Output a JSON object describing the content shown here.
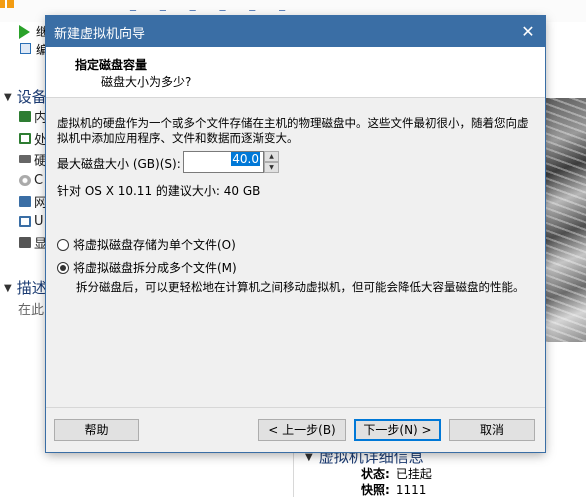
{
  "background": {
    "sidebar": {
      "truncated_items": [
        "继",
        "编"
      ],
      "devices_heading": "设备",
      "device_items": [
        {
          "label": "内",
          "icon": "memory-icon",
          "color": "#2e7d32"
        },
        {
          "label": "处",
          "icon": "processor-icon",
          "color": "#2e7d32"
        },
        {
          "label": "硬",
          "icon": "harddisk-icon",
          "color": "#555555"
        },
        {
          "label": "C",
          "icon": "cdrom-icon",
          "color": "#888888"
        },
        {
          "label": "网",
          "icon": "network-icon",
          "color": "#3a6ea5"
        },
        {
          "label": "U",
          "icon": "usb-icon",
          "color": "#3a6ea5"
        },
        {
          "label": "显",
          "icon": "display-icon",
          "color": "#555555"
        }
      ],
      "description_heading": "描述",
      "description_hint": "在此"
    },
    "details": {
      "heading": "虚拟机详细信息",
      "status_label": "状态:",
      "status_value": "已挂起",
      "snapshot_label": "快照:",
      "snapshot_value": "1111"
    }
  },
  "dialog": {
    "title": "新建虚拟机向导",
    "close_glyph": "✕",
    "header_title": "指定磁盘容量",
    "header_subtitle": "磁盘大小为多少?",
    "description": "虚拟机的硬盘作为一个或多个文件存储在主机的物理磁盘中。这些文件最初很小，随着您向虚拟机中添加应用程序、文件和数据而逐渐变大。",
    "max_size_label": "最大磁盘大小 (GB)(S):",
    "max_size_value": "40.0",
    "recommended": "针对 OS X 10.11 的建议大小: 40 GB",
    "options": [
      {
        "label": "将虚拟磁盘存储为单个文件(O)",
        "checked": false
      },
      {
        "label": "将虚拟磁盘拆分成多个文件(M)",
        "checked": true
      }
    ],
    "split_note": "拆分磁盘后，可以更轻松地在计算机之间移动虚拟机，但可能会降低大容量磁盘的性能。",
    "buttons": {
      "help": "帮助",
      "back": "< 上一步(B)",
      "next": "下一步(N) >",
      "cancel": "取消"
    },
    "accent_color": "#3a6ea5",
    "selection_color": "#0078d7"
  }
}
